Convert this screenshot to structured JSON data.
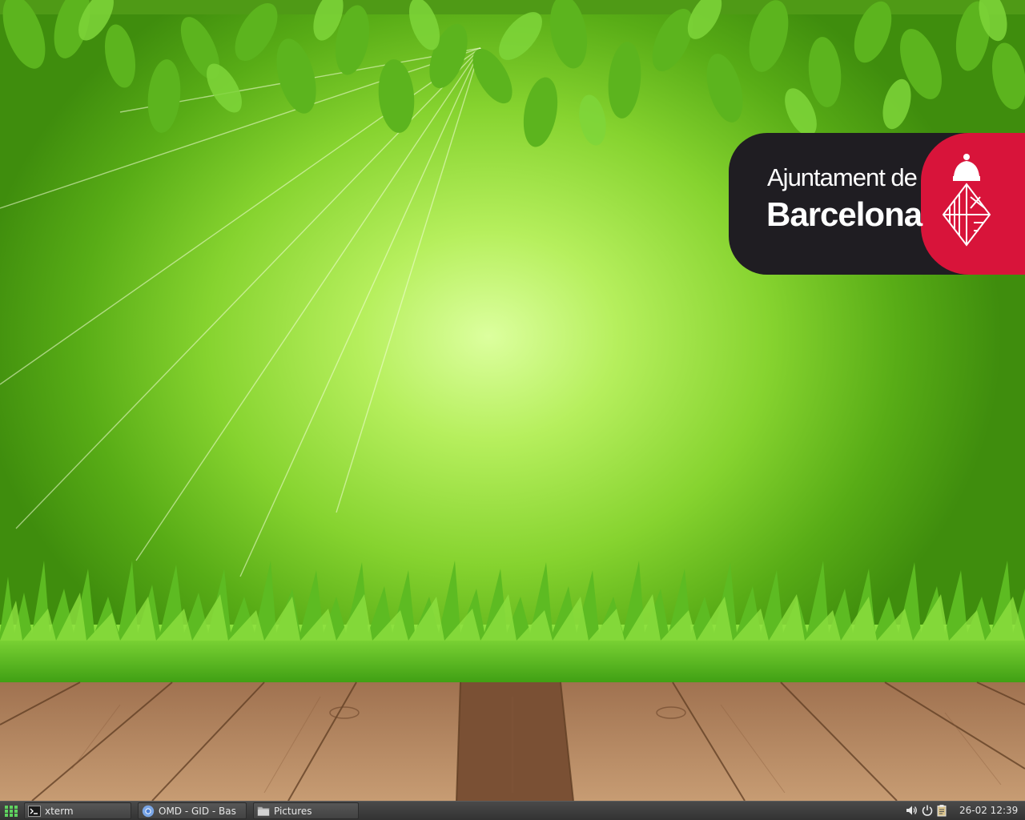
{
  "desktop": {
    "wallpaper_logo": {
      "line1": "Ajuntament de",
      "line2": "Barcelona"
    }
  },
  "taskbar": {
    "menu_icon": "apps-grid-icon",
    "tasks": [
      {
        "label": "xterm",
        "icon": "terminal-icon"
      },
      {
        "label": "OMD - GID - Bas",
        "icon": "chromium-icon"
      },
      {
        "label": "Pictures",
        "icon": "folder-icon"
      }
    ],
    "tray": {
      "volume_icon": "volume-icon",
      "power_icon": "power-icon",
      "clipboard_icon": "clipboard-icon"
    },
    "clock": "26-02 12:39"
  },
  "colors": {
    "taskbar_bg": "#3c3c3c",
    "logo_dark": "#1f1d22",
    "logo_red": "#d8143a",
    "menu_green": "#5fd35f"
  }
}
